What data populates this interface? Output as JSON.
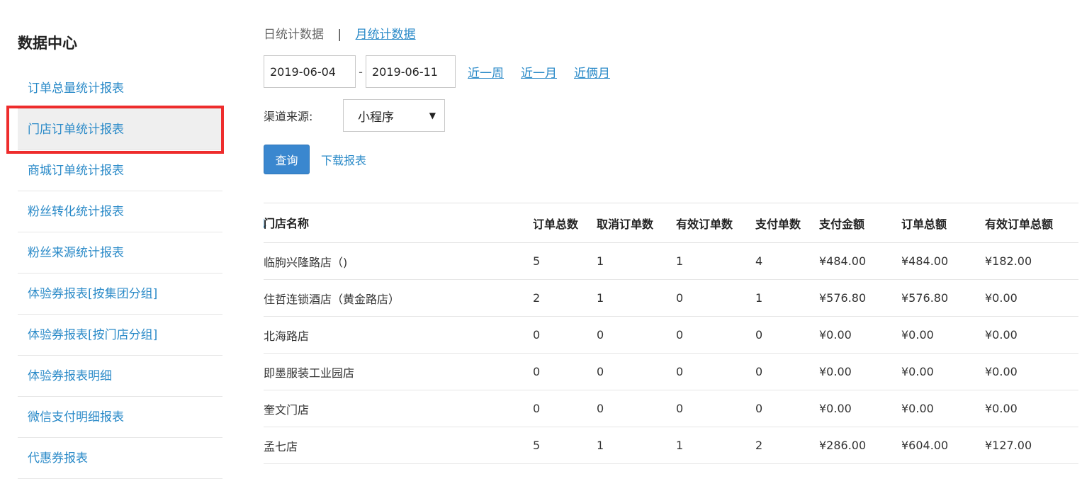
{
  "sidebar": {
    "title": "数据中心",
    "items": [
      {
        "label": "订单总量统计报表"
      },
      {
        "label": "门店订单统计报表"
      },
      {
        "label": "商城订单统计报表"
      },
      {
        "label": "粉丝转化统计报表"
      },
      {
        "label": "粉丝来源统计报表"
      },
      {
        "label": "体验券报表[按集团分组]"
      },
      {
        "label": "体验券报表[按门店分组]"
      },
      {
        "label": "体验券报表明细"
      },
      {
        "label": "微信支付明细报表"
      },
      {
        "label": "代惠券报表"
      }
    ],
    "active_index": 1,
    "active_highlight_color": "#ee2c2c"
  },
  "tabs": {
    "daily": "日统计数据",
    "separator": "|",
    "monthly": "月统计数据"
  },
  "date_filter": {
    "start": "2019-06-04",
    "separator": "-",
    "end": "2019-06-11",
    "quick_links": [
      "近一周",
      "近一月",
      "近俩月"
    ]
  },
  "channel": {
    "label": "渠道来源:",
    "selected": "小程序"
  },
  "actions": {
    "query": "查询",
    "download": "下载报表"
  },
  "table": {
    "sort_icon": "sort-down-arrow-icon",
    "columns": [
      "门店名称",
      "订单总数",
      "取消订单数",
      "有效订单数",
      "支付单数",
      "支付金额",
      "订单总额",
      "有效订单总额"
    ],
    "rows": [
      [
        "临朐兴隆路店（)",
        "5",
        "1",
        "1",
        "4",
        "¥484.00",
        "¥484.00",
        "¥182.00"
      ],
      [
        "住哲连锁酒店（黄金路店）",
        "2",
        "1",
        "0",
        "1",
        "¥576.80",
        "¥576.80",
        "¥0.00"
      ],
      [
        "北海路店",
        "0",
        "0",
        "0",
        "0",
        "¥0.00",
        "¥0.00",
        "¥0.00"
      ],
      [
        "即墨服装工业园店",
        "0",
        "0",
        "0",
        "0",
        "¥0.00",
        "¥0.00",
        "¥0.00"
      ],
      [
        "奎文门店",
        "0",
        "0",
        "0",
        "0",
        "¥0.00",
        "¥0.00",
        "¥0.00"
      ],
      [
        "孟七店",
        "5",
        "1",
        "1",
        "2",
        "¥286.00",
        "¥604.00",
        "¥127.00"
      ]
    ]
  },
  "colors": {
    "link": "#2a8ac8",
    "primary_button": "#3a87cf"
  }
}
